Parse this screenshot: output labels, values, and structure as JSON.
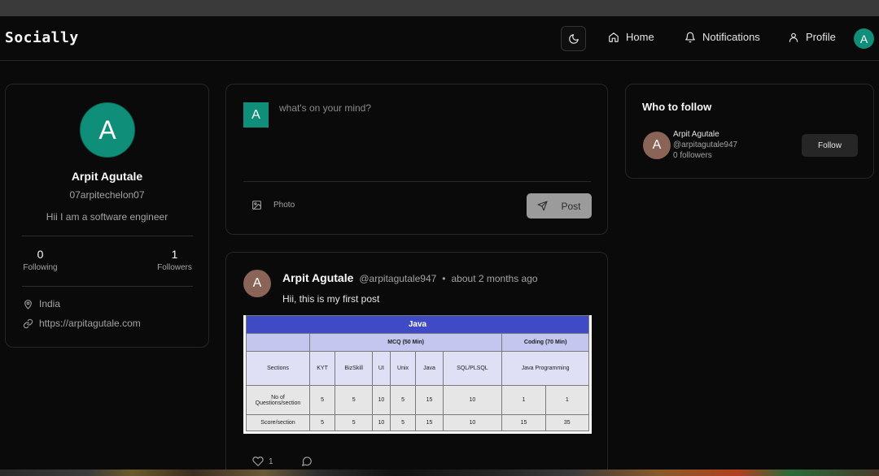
{
  "app": {
    "brand": "Socially"
  },
  "nav": {
    "home": "Home",
    "notifications": "Notifications",
    "profile": "Profile",
    "avatar_initial": "A"
  },
  "profile": {
    "avatar_initial": "A",
    "name": "Arpit Agutale",
    "handle": "07arpitechelon07",
    "bio": "Hii I am a software engineer",
    "following_count": "0",
    "following_label": "Following",
    "followers_count": "1",
    "followers_label": "Followers",
    "location": "India",
    "website": "https://arpitagutale.com"
  },
  "compose": {
    "avatar_initial": "A",
    "placeholder": "what's on your mind?",
    "photo_label": "Photo",
    "post_label": "Post"
  },
  "post": {
    "avatar_initial": "A",
    "author": "Arpit Agutale",
    "handle": "@arpitagutale947",
    "separator": "•",
    "time": "about 2 months ago",
    "text": "Hii, this is my first post",
    "likes": "1",
    "image_table": {
      "title": "Java",
      "group_mcq": "MCQ (50 Min)",
      "group_coding": "Coding (70 Min)",
      "sections_label": "Sections",
      "columns": [
        "KYT",
        "BizSkill",
        "UI",
        "Unix",
        "Java",
        "SQL/PLSQL",
        "Java Programming"
      ],
      "row1_label": "No of Questions/section",
      "row1": [
        "5",
        "5",
        "10",
        "5",
        "15",
        "10",
        "1",
        "1"
      ],
      "row2_label": "Score/section",
      "row2": [
        "5",
        "5",
        "10",
        "5",
        "15",
        "10",
        "15",
        "35"
      ]
    }
  },
  "who_to_follow": {
    "title": "Who to follow",
    "avatar_initial": "A",
    "name": "Arpit Agutale",
    "handle": "@arpitagutale947",
    "followers": "0 followers",
    "button": "Follow"
  },
  "colors": {
    "accent_teal": "#0f8f7a",
    "avatar_brown": "#8a6457",
    "background": "#0a0a0a"
  }
}
